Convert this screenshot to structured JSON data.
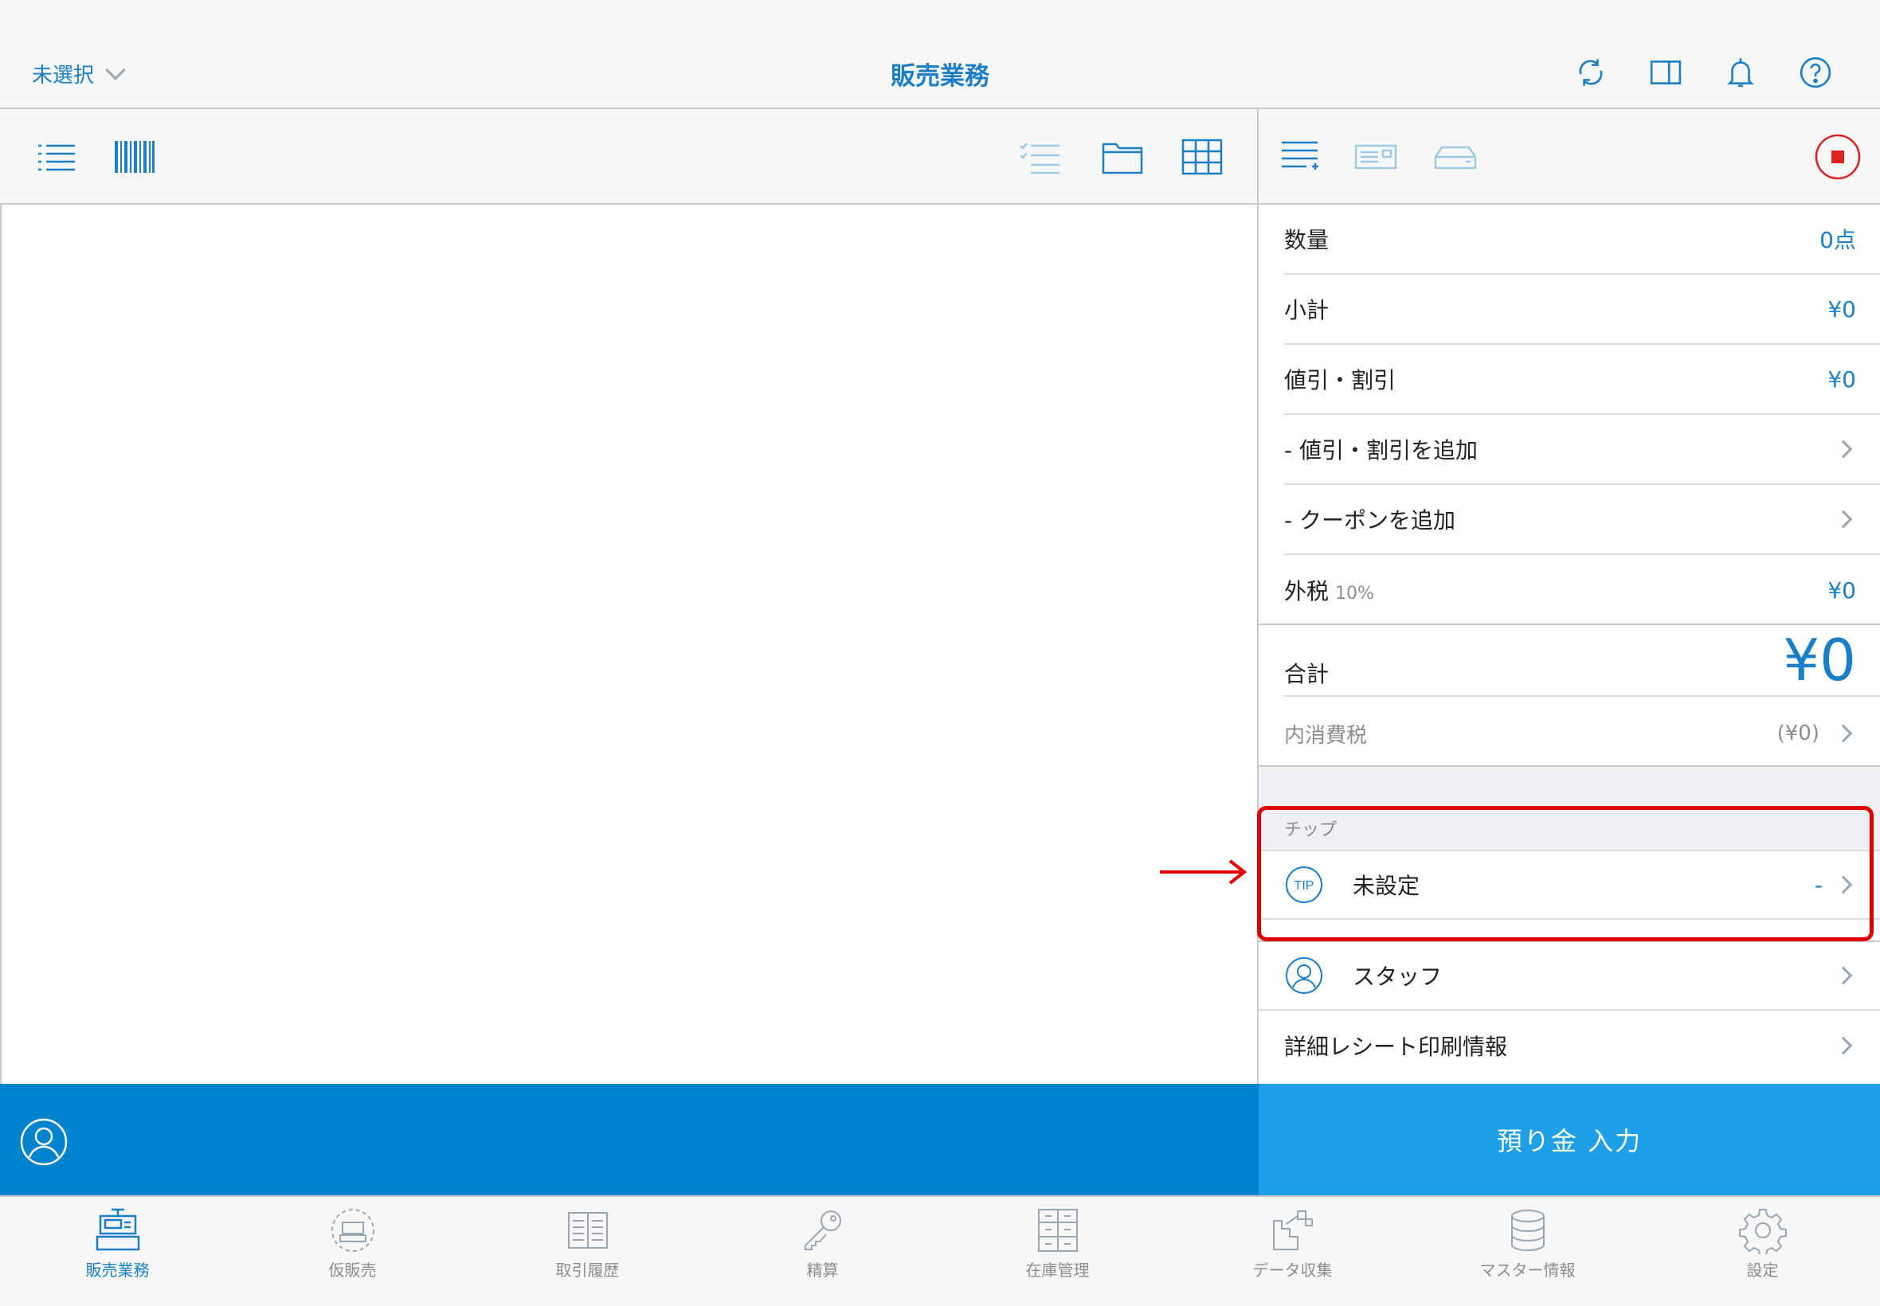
{
  "header": {
    "store_select": "未選択",
    "title": "販売業務",
    "icons": [
      "sync-icon",
      "split-view-icon",
      "bell-icon",
      "help-icon"
    ]
  },
  "toolbar_left": {
    "icons": [
      "list-icon",
      "barcode-icon",
      "checklist-icon",
      "folder-icon",
      "grid-icon"
    ]
  },
  "toolbar_right": {
    "icons": [
      "add-line-icon",
      "card-reader-icon",
      "drawer-icon",
      "stop-icon"
    ]
  },
  "summary": {
    "quantity_label": "数量",
    "quantity_value": "0点",
    "subtotal_label": "小計",
    "subtotal_value": "¥0",
    "discount_label": "値引・割引",
    "discount_value": "¥0",
    "add_discount_label": "- 値引・割引を追加",
    "add_coupon_label": "- クーポンを追加",
    "tax_label": "外税",
    "tax_rate": "10%",
    "tax_value": "¥0",
    "total_label": "合計",
    "total_value": "¥0",
    "inclusive_tax_label": "内消費税",
    "inclusive_tax_value": "(¥0)"
  },
  "tip": {
    "header": "チップ",
    "label": "未設定",
    "value": "-"
  },
  "staff": {
    "label": "スタッフ"
  },
  "receipt": {
    "label": "詳細レシート印刷情報"
  },
  "deposit_button": "預り金 入力",
  "tabs": [
    {
      "label": "販売業務",
      "active": true
    },
    {
      "label": "仮販売",
      "active": false
    },
    {
      "label": "取引履歴",
      "active": false
    },
    {
      "label": "精算",
      "active": false
    },
    {
      "label": "在庫管理",
      "active": false
    },
    {
      "label": "データ収集",
      "active": false
    },
    {
      "label": "マスター情報",
      "active": false
    },
    {
      "label": "設定",
      "active": false
    }
  ],
  "colors": {
    "accent": "#1a7fc7",
    "bar_blue": "#0083cd",
    "button_blue": "#1da0e8",
    "highlight_red": "#e00000"
  }
}
